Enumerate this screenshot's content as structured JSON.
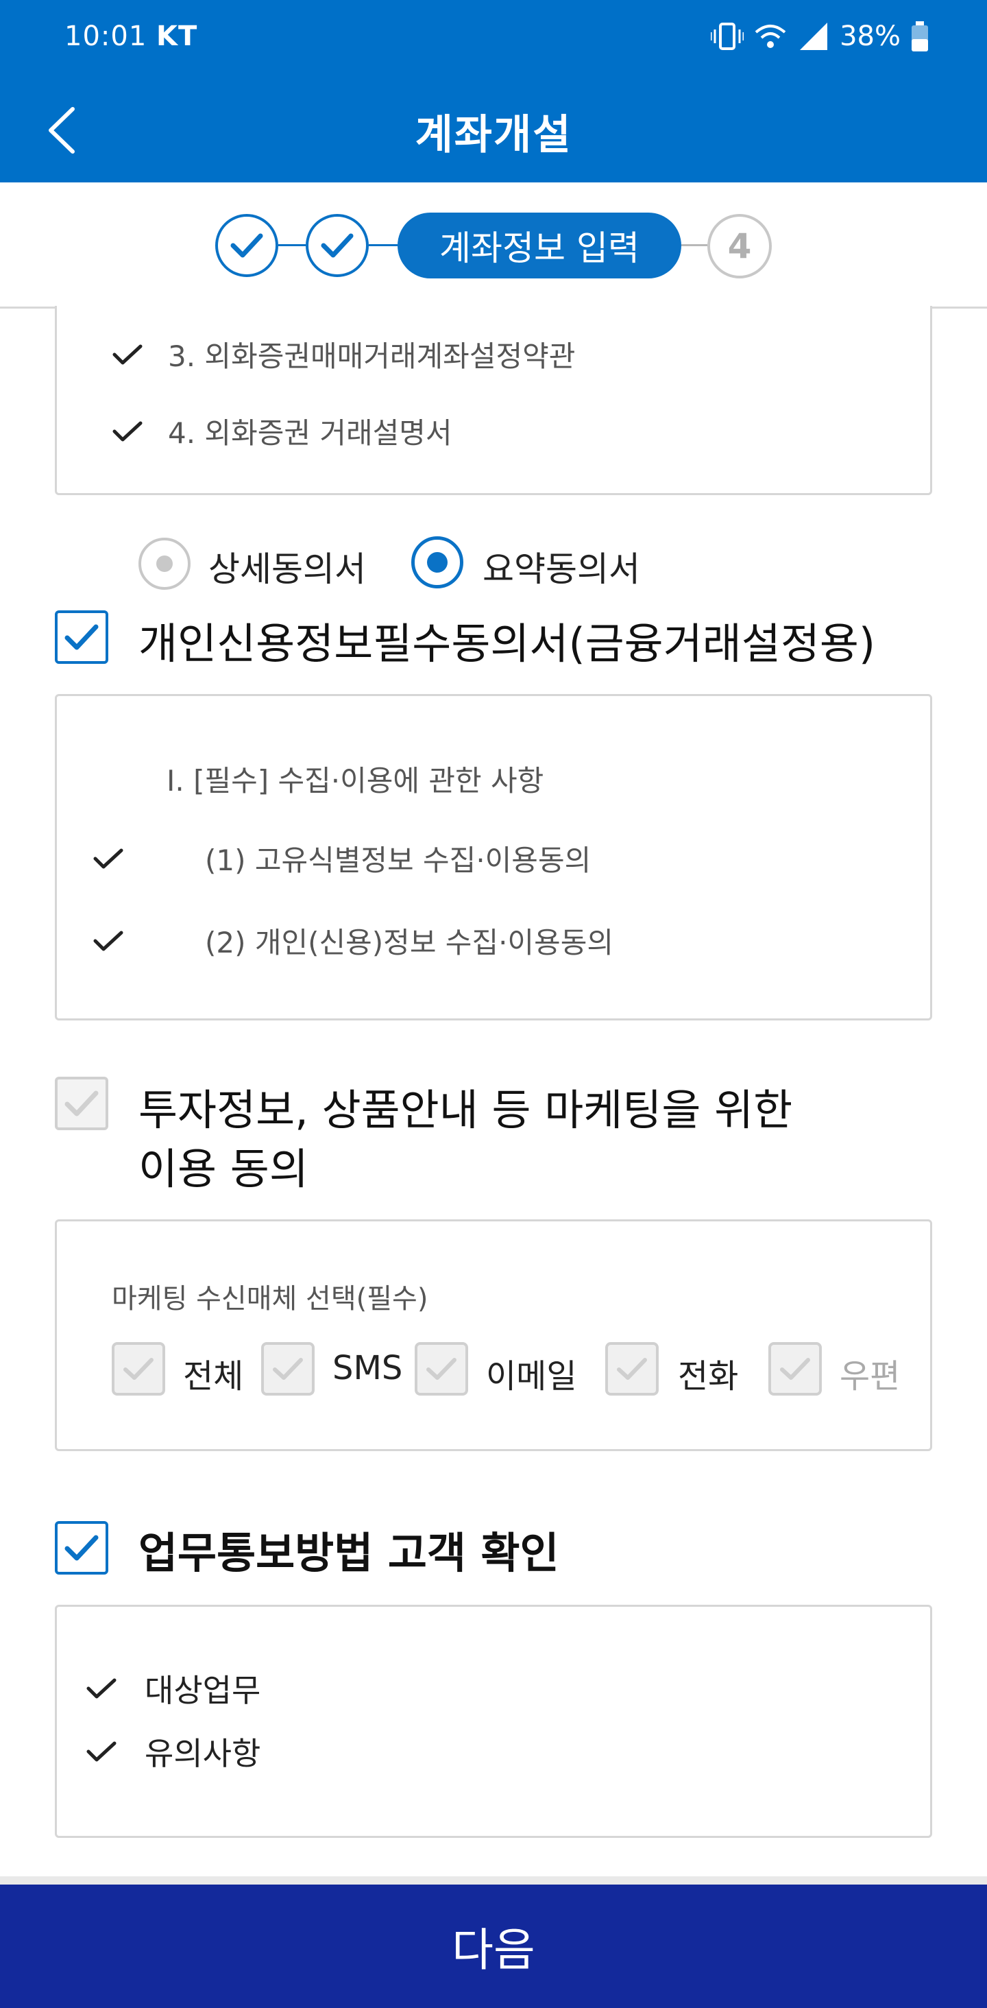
{
  "status": {
    "time": "10:01",
    "carrier": "KT",
    "battery": "38%"
  },
  "appbar": {
    "title": "계좌개설"
  },
  "stepper": {
    "active_label": "계좌정보 입력",
    "future_label": "4"
  },
  "doc_box": {
    "items": [
      "3. 외화증권매매거래계좌설정약관",
      "4. 외화증권 거래설명서"
    ]
  },
  "consent_type": {
    "option1": "상세동의서",
    "option2": "요약동의서",
    "selected": "요약동의서"
  },
  "credit": {
    "title": "개인신용정보필수동의서(금융거래설정용)",
    "heading": "I. [필수] 수집·이용에 관한 사항",
    "items": [
      "(1) 고유식별정보 수집·이용동의",
      "(2) 개인(신용)정보 수집·이용동의"
    ]
  },
  "marketing": {
    "title_line1": "투자정보, 상품안내 등 마케팅을 위한",
    "title_line2": "이용 동의",
    "media_label": "마케팅 수신매체 선택(필수)",
    "options": [
      "전체",
      "SMS",
      "이메일",
      "전화",
      "우편"
    ]
  },
  "notice": {
    "title": "업무통보방법 고객 확인",
    "items": [
      "대상업무",
      "유의사항"
    ]
  },
  "footer": {
    "next_label": "다음"
  },
  "colors": {
    "primary": "#0070c8",
    "bottom": "#13299b"
  }
}
